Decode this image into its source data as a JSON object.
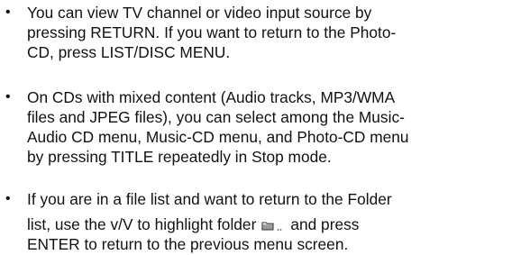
{
  "notes": {
    "bullet_glyph": "•",
    "items": [
      {
        "lines": [
          "You can view TV channel or video input source by",
          "pressing RETURN. If you want to return to the Photo-",
          "CD, press LIST/DISC MENU."
        ]
      },
      {
        "lines": [
          "On CDs with mixed content (Audio tracks, MP3/WMA",
          "files and JPEG files), you can select among the Music-",
          "Audio CD menu, Music-CD menu, and Photo-CD menu",
          "by pressing TITLE repeatedly in Stop mode."
        ]
      },
      {
        "lines": [
          "If you are in a file list and want to return to the Folder",
          "list, use the v/V to highlight folder",
          "and press",
          "ENTER to return to the previous menu screen."
        ]
      }
    ]
  }
}
